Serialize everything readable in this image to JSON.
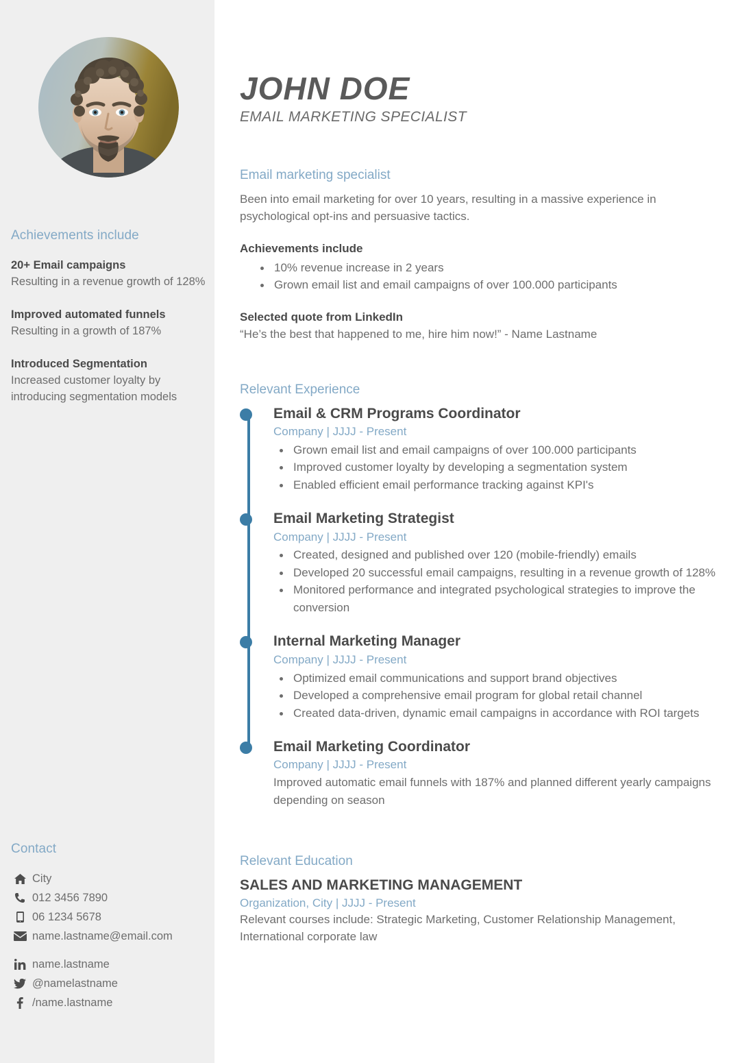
{
  "header": {
    "name": "JOHN  DOE",
    "job_title": "EMAIL MARKETING SPECIALIST",
    "photo_alt": "profile-photo"
  },
  "sidebar": {
    "achievements": {
      "heading": "Achievements include",
      "items": [
        {
          "title": "20+ Email campaigns",
          "desc": "Resulting in a revenue growth of 128%"
        },
        {
          "title": "Improved automated funnels",
          "desc": "Resulting in a growth of 187%"
        },
        {
          "title": "Introduced Segmentation",
          "desc": "Increased customer loyalty by introducing segmentation models"
        }
      ]
    },
    "contact": {
      "heading": "Contact",
      "primary": [
        {
          "icon": "home-icon",
          "text": "City"
        },
        {
          "icon": "phone-icon",
          "text": "012 3456 7890"
        },
        {
          "icon": "mobile-icon",
          "text": "06 1234 5678"
        },
        {
          "icon": "envelope-icon",
          "text": "name.lastname@email.com"
        }
      ],
      "social": [
        {
          "icon": "linkedin-icon",
          "text": "name.lastname"
        },
        {
          "icon": "twitter-icon",
          "text": "@namelastname"
        },
        {
          "icon": "facebook-icon",
          "text": "/name.lastname"
        }
      ]
    }
  },
  "main": {
    "summary": {
      "heading": "Email marketing specialist",
      "body": "Been into email marketing for over 10 years, resulting in a massive experience in psychological opt-ins and persuasive tactics.",
      "achievements_label": "Achievements include",
      "achievements": [
        "10% revenue increase in 2 years",
        "Grown email list and email campaigns of over 100.000 participants"
      ],
      "quote_label": "Selected quote from LinkedIn",
      "quote": "“He’s the best that happened to me, hire him now!” - Name Lastname"
    },
    "experience": {
      "heading": "Relevant Experience",
      "items": [
        {
          "title": "Email & CRM Programs Coordinator",
          "company": "Company | JJJJ - Present",
          "bullets": [
            "Grown email list and email campaigns of over 100.000 participants",
            "Improved customer loyalty by developing a segmentation system",
            "Enabled efficient email performance tracking against KPI's"
          ],
          "paragraph": ""
        },
        {
          "title": "Email Marketing Strategist",
          "company": "Company | JJJJ - Present",
          "bullets": [
            "Created, designed and published over 120 (mobile-friendly) emails",
            "Developed 20 successful email campaigns, resulting in a revenue growth of 128%",
            "Monitored performance and integrated psychological strategies to improve the conversion"
          ],
          "paragraph": ""
        },
        {
          "title": "Internal Marketing Manager",
          "company": "Company | JJJJ - Present",
          "bullets": [
            "Optimized email communications and support brand objectives",
            "Developed a comprehensive email program for global retail channel",
            "Created data-driven, dynamic email campaigns in accordance with ROI targets"
          ],
          "paragraph": ""
        },
        {
          "title": "Email Marketing Coordinator",
          "company": "Company | JJJJ - Present",
          "bullets": [],
          "paragraph": "Improved automatic email funnels with 187% and planned different yearly campaigns depending on season"
        }
      ]
    },
    "education": {
      "heading": "Relevant Education",
      "title": "SALES AND MARKETING MANAGEMENT",
      "organization": "Organization, City | JJJJ - Present",
      "description": "Relevant courses include: Strategic Marketing, Customer Relationship Management, International corporate law"
    }
  },
  "theme": {
    "sidebar_bg": "#efefef",
    "accent_blue": "#83a9c6",
    "timeline_blue": "#3c7da6",
    "heading_gray": "#4a4a4a",
    "body_gray": "#6d6d6d"
  }
}
